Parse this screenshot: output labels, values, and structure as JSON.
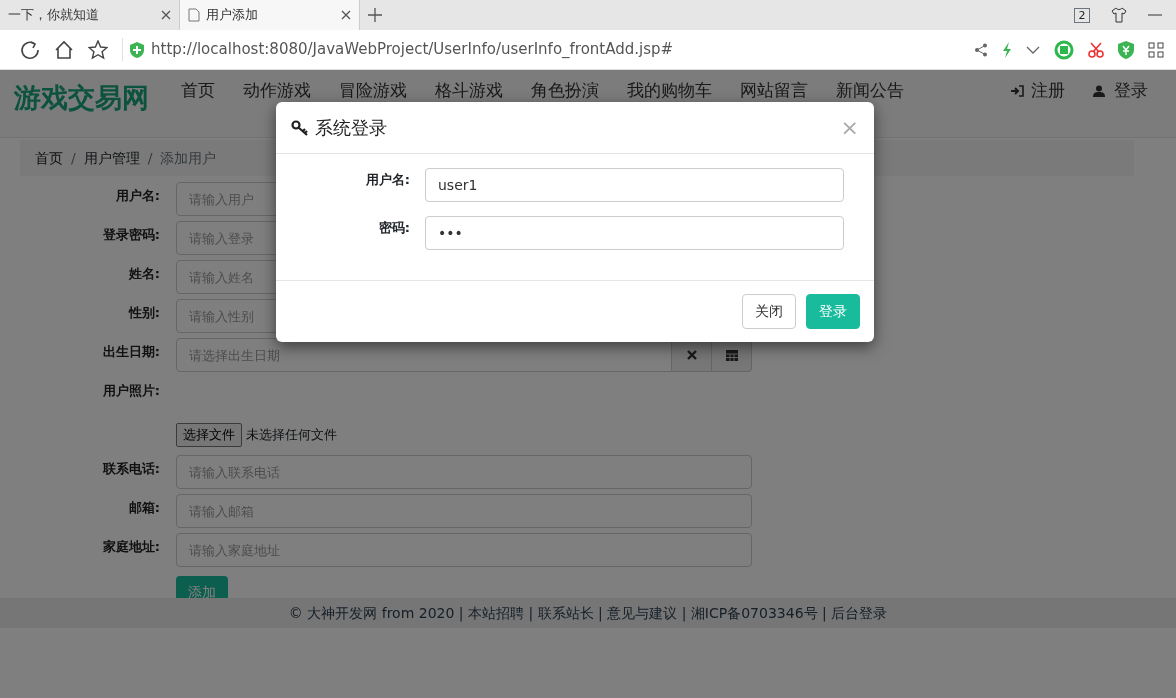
{
  "browser": {
    "tabs": [
      {
        "title": "一下，你就知道",
        "selected": false
      },
      {
        "title": "用户添加",
        "selected": true
      }
    ],
    "tab_count": "2",
    "url": "http://localhost:8080/JavaWebProject/UserInfo/userInfo_frontAdd.jsp#"
  },
  "navbar": {
    "brand": "游戏交易网",
    "items": [
      {
        "label": "首页"
      },
      {
        "label": "动作游戏"
      },
      {
        "label": "冒险游戏"
      },
      {
        "label": "格斗游戏"
      },
      {
        "label": "角色扮演"
      },
      {
        "label": "我的购物车"
      },
      {
        "label": "网站留言"
      },
      {
        "label": "新闻公告"
      }
    ],
    "right": [
      {
        "label": "注册",
        "kind": "register"
      },
      {
        "label": "登录",
        "kind": "login"
      }
    ]
  },
  "breadcrumb": {
    "separator": "/",
    "items": [
      {
        "label": "首页",
        "link": true
      },
      {
        "label": "用户管理",
        "link": true
      },
      {
        "label": "添加用户",
        "link": false
      }
    ]
  },
  "form": {
    "fields": [
      {
        "label": "用户名:",
        "kind": "text",
        "placeholder": "请输入用户"
      },
      {
        "label": "登录密码:",
        "kind": "text",
        "placeholder": "请输入登录"
      },
      {
        "label": "姓名:",
        "kind": "text",
        "placeholder": "请输入姓名"
      },
      {
        "label": "性别:",
        "kind": "text",
        "placeholder": "请输入性别"
      },
      {
        "label": "出生日期:",
        "kind": "date",
        "placeholder": "请选择出生日期"
      },
      {
        "label": "用户照片:",
        "kind": "file",
        "button": "选择文件",
        "status": "未选择任何文件"
      },
      {
        "label": "联系电话:",
        "kind": "text",
        "placeholder": "请输入联系电话"
      },
      {
        "label": "邮箱:",
        "kind": "text",
        "placeholder": "请输入邮箱"
      },
      {
        "label": "家庭地址:",
        "kind": "text",
        "placeholder": "请输入家庭地址"
      }
    ],
    "submit": "添加"
  },
  "footer": "© 大神开发网 from 2020 | 本站招聘 | 联系站长 | 意见与建议 | 湘ICP备0703346号 | 后台登录",
  "modal": {
    "title": "系统登录",
    "close": "×",
    "fields": [
      {
        "label": "用户名:",
        "value": "user1"
      },
      {
        "label": "密码:",
        "value": "•••"
      }
    ],
    "buttons": [
      {
        "label": "关闭",
        "kind": "secondary"
      },
      {
        "label": "登录",
        "kind": "primary"
      }
    ]
  }
}
